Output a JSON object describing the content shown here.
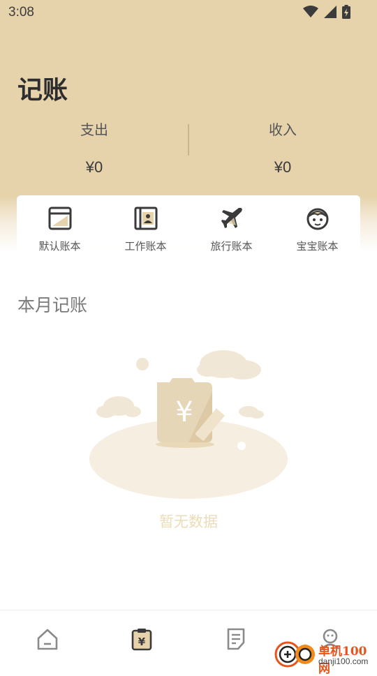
{
  "status_bar": {
    "time": "3:08",
    "icons": [
      "wifi-icon",
      "signal-icon",
      "battery-icon"
    ]
  },
  "header": {
    "title": "记账"
  },
  "stats": {
    "expense": {
      "label": "支出",
      "value": "¥0"
    },
    "income": {
      "label": "收入",
      "value": "¥0"
    }
  },
  "books": [
    {
      "label": "默认账本",
      "icon": "default-book-icon"
    },
    {
      "label": "工作账本",
      "icon": "work-book-icon"
    },
    {
      "label": "旅行账本",
      "icon": "airplane-icon"
    },
    {
      "label": "宝宝账本",
      "icon": "baby-face-icon"
    }
  ],
  "section": {
    "title": "本月记账"
  },
  "empty_state": {
    "text": "暂无数据"
  },
  "bottom_nav": [
    {
      "name": "home-icon"
    },
    {
      "name": "ledger-icon",
      "active": true
    },
    {
      "name": "notes-icon"
    },
    {
      "name": "profile-icon"
    }
  ],
  "watermark": {
    "title": "单机100网",
    "url": "danji100.com"
  },
  "colors": {
    "header_bg": "#e6d3ac",
    "accent": "#5a4a32",
    "empty_text": "#ecdcb8"
  }
}
